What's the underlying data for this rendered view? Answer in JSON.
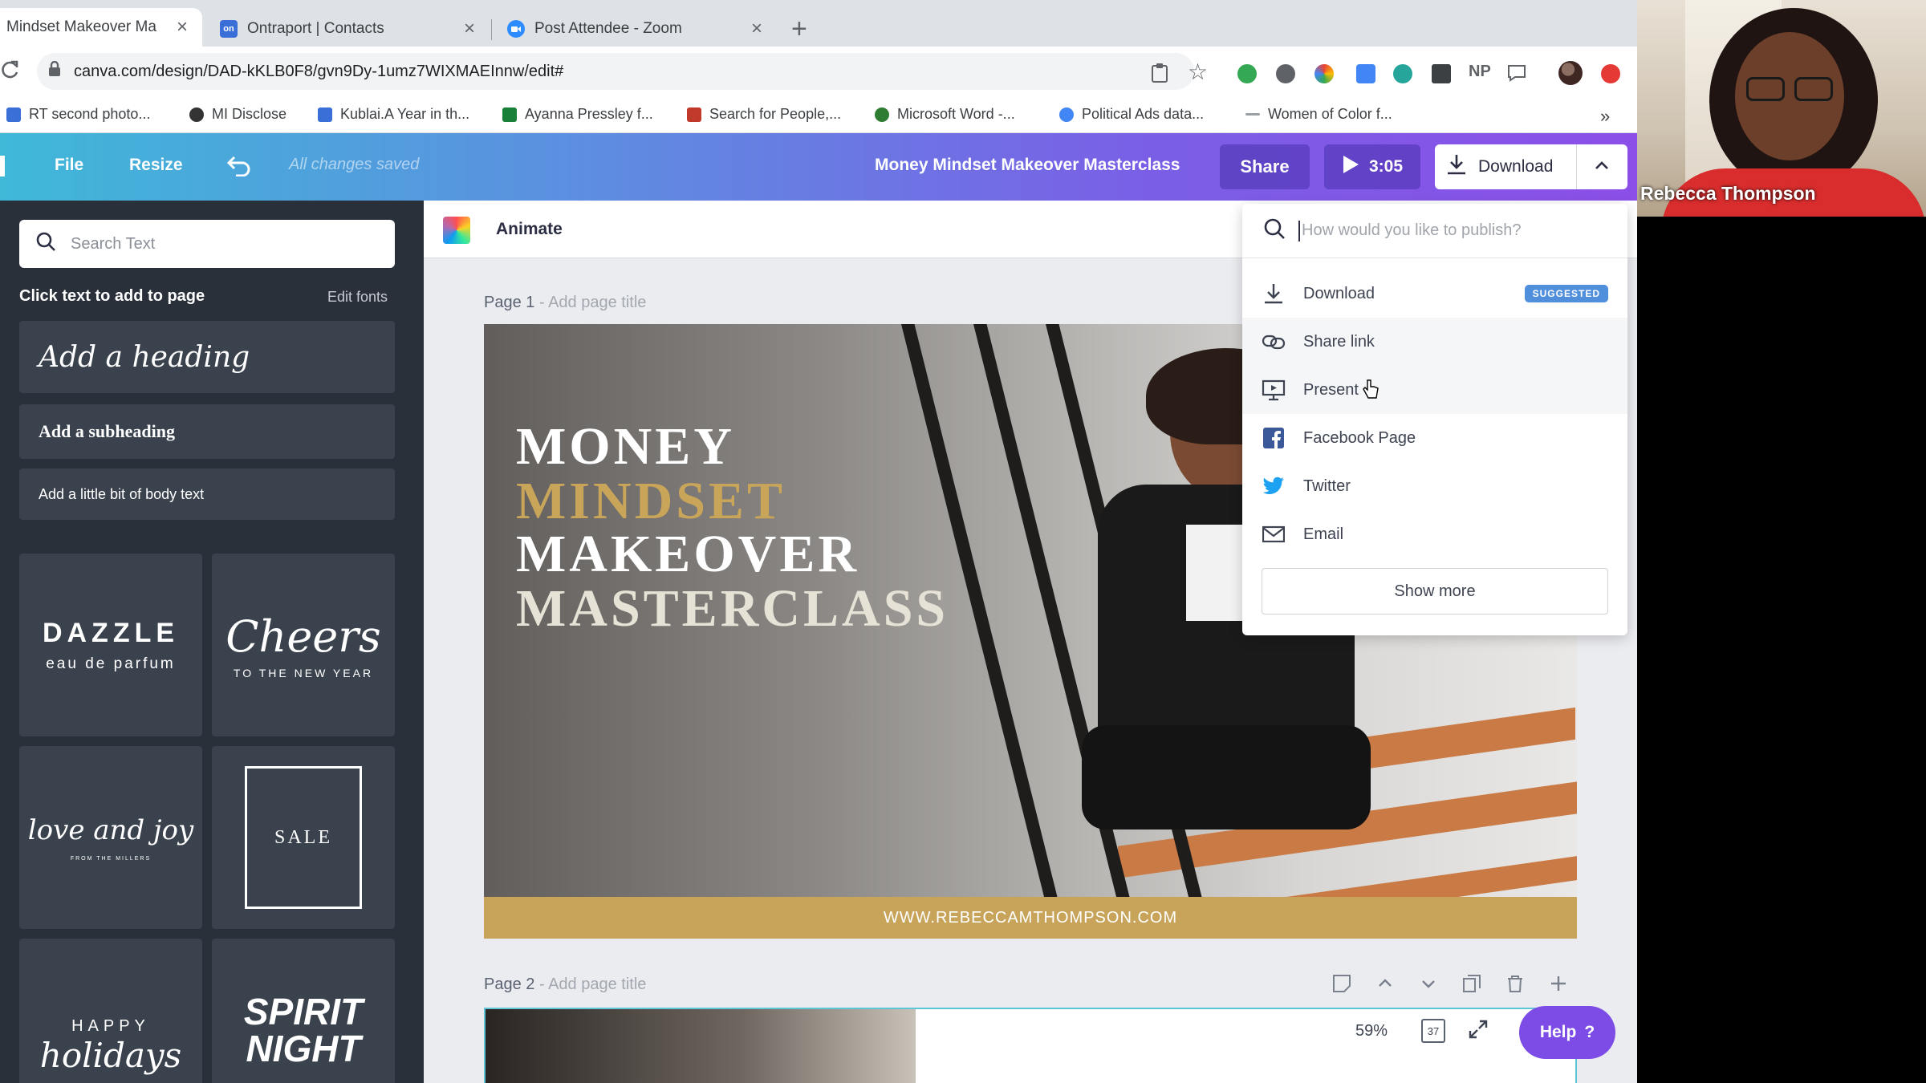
{
  "browser": {
    "tabs": [
      {
        "title": "Mindset Makeover Ma",
        "favicon_color": "#ffffff",
        "favicon_label": "",
        "active": true
      },
      {
        "title": "Ontraport | Contacts",
        "favicon_color": "#3b6fd8",
        "favicon_label": "on",
        "active": false
      },
      {
        "title": "Post Attendee - Zoom",
        "favicon_color": "#2d8cff",
        "favicon_label": "",
        "active": false
      }
    ],
    "close_glyph": "×",
    "new_tab_glyph": "+",
    "url": "canva.com/design/DAD-kKLB0F8/gvn9Dy-1umz7WIXMAEInnw/edit#",
    "profile_label": "NP",
    "bookmarks": [
      {
        "label": "RT second photo...",
        "icon_color": "#3b6fd8"
      },
      {
        "label": "MI Disclose",
        "icon_color": "#333333"
      },
      {
        "label": "Kublai.A Year in th...",
        "icon_color": "#3b6fd8"
      },
      {
        "label": "Ayanna Pressley f...",
        "icon_color": "#188038"
      },
      {
        "label": "Search for People,...",
        "icon_color": "#c0392b"
      },
      {
        "label": "Microsoft Word -...",
        "icon_color": "#2e7d32"
      },
      {
        "label": "Political Ads data...",
        "icon_color": "#4285f4"
      },
      {
        "label": "Women of Color f...",
        "icon_color": "#9aa0a6"
      }
    ],
    "overflow_glyph": "»"
  },
  "canva": {
    "menu_file": "File",
    "menu_resize": "Resize",
    "saved_status": "All changes saved",
    "design_title": "Money Mindset Makeover Masterclass",
    "share_label": "Share",
    "play_duration": "3:05",
    "download_label": "Download",
    "accent": "#7d4ce6"
  },
  "left_panel": {
    "search_placeholder": "Search Text",
    "heading": "Click text to add to page",
    "edit_fonts": "Edit fonts",
    "presets": [
      "Add a heading",
      "Add a subheading",
      "Add a little bit of body text"
    ],
    "tiles": [
      {
        "line1": "DAZZLE",
        "line2": "eau de parfum"
      },
      {
        "line1": "Cheers",
        "line2": "TO THE NEW YEAR"
      },
      {
        "line1": "love and joy",
        "line2": "FROM THE MILLERS"
      },
      {
        "line1": "SALE",
        "line2": ""
      },
      {
        "line1": "HAPPY",
        "line2": "holidays"
      },
      {
        "line1": "SPIRIT NIGHT",
        "line2": ""
      }
    ]
  },
  "workspace": {
    "animate_label": "Animate",
    "page1_label": "Page 1",
    "page1_sub": "- Add page title",
    "page2_label": "Page 2",
    "page2_sub": "- Add page title",
    "design": {
      "headline": [
        "MONEY",
        "MINDSET",
        "MAKEOVER",
        "MASTERCLASS"
      ],
      "headline_colors": [
        "#ffffff",
        "#c9a55a",
        "#ffffff",
        "#e6e2d6"
      ],
      "website": "WWW.REBECCAMTHOMPSON.COM",
      "band_color": "#c7a45a"
    },
    "zoom": "59%",
    "page_count": "37",
    "help_label": "Help",
    "help_glyph": "?"
  },
  "publish_menu": {
    "search_placeholder": "How would you like to publish?",
    "items": [
      {
        "label": "Download",
        "icon": "download-icon",
        "badge": "SUGGESTED"
      },
      {
        "label": "Share link",
        "icon": "link-icon",
        "badge": ""
      },
      {
        "label": "Present",
        "icon": "present-icon",
        "badge": ""
      },
      {
        "label": "Facebook Page",
        "icon": "facebook-icon",
        "badge": ""
      },
      {
        "label": "Twitter",
        "icon": "twitter-icon",
        "badge": ""
      },
      {
        "label": "Email",
        "icon": "email-icon",
        "badge": ""
      }
    ],
    "show_more": "Show more"
  },
  "video": {
    "participant_name": "Rebecca Thompson"
  }
}
